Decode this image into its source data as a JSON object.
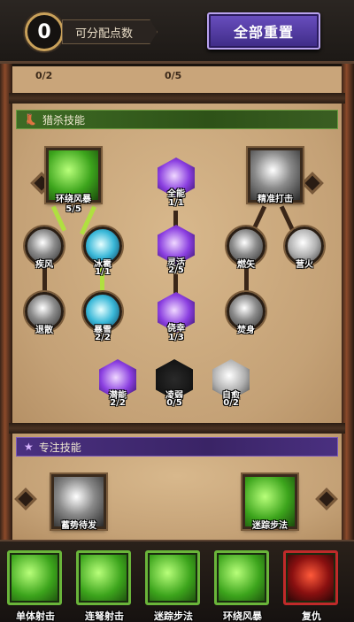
{
  "points": {
    "value": "0",
    "label": "可分配点数"
  },
  "reset_button": {
    "label": "全部重置"
  },
  "top_counters": [
    "0/2",
    "0/5"
  ],
  "hunting_section": {
    "title": "猎杀技能",
    "nodes": [
      {
        "name": "环绕风暴",
        "count": "5/5",
        "icon": "whirlwind-icon",
        "color": "green"
      },
      {
        "name": "全能",
        "count": "1/1",
        "icon": "versatility-icon",
        "color": "purple"
      },
      {
        "name": "精准打击",
        "count": "",
        "icon": "precise-strike-icon",
        "color": "gray"
      },
      {
        "name": "疾风",
        "count": "",
        "icon": "gale-icon",
        "color": "gray"
      },
      {
        "name": "冰雹",
        "count": "1/1",
        "icon": "hail-icon",
        "color": "cyan"
      },
      {
        "name": "灵活",
        "count": "2/5",
        "icon": "agility-icon",
        "color": "purple"
      },
      {
        "name": "燃矢",
        "count": "",
        "icon": "burning-arrow-icon",
        "color": "gray"
      },
      {
        "name": "营火",
        "count": "",
        "icon": "campfire-icon",
        "color": "gray"
      },
      {
        "name": "退散",
        "count": "",
        "icon": "disperse-icon",
        "color": "gray"
      },
      {
        "name": "暴雪",
        "count": "2/2",
        "icon": "blizzard-icon",
        "color": "cyan"
      },
      {
        "name": "侥幸",
        "count": "1/3",
        "icon": "luck-icon",
        "color": "purple"
      },
      {
        "name": "焚身",
        "count": "",
        "icon": "self-immolate-icon",
        "color": "gray"
      },
      {
        "name": "潜能",
        "count": "2/2",
        "icon": "potential-icon",
        "color": "purple"
      },
      {
        "name": "凌弱",
        "count": "0/5",
        "icon": "bully-icon",
        "color": "dark"
      },
      {
        "name": "自愈",
        "count": "0/2",
        "icon": "self-heal-icon",
        "color": "silver"
      }
    ]
  },
  "focus_section": {
    "title": "专注技能",
    "nodes": [
      {
        "name": "蓄势待发",
        "icon": "charge-icon"
      },
      {
        "name": "迷踪步法",
        "icon": "elusive-step-icon"
      }
    ]
  },
  "bottom_bar": [
    {
      "name": "单体射击",
      "icon": "single-shot-icon"
    },
    {
      "name": "连弩射击",
      "icon": "crossbow-volley-icon"
    },
    {
      "name": "迷踪步法",
      "icon": "elusive-step-icon"
    },
    {
      "name": "环绕风暴",
      "icon": "whirlwind-icon"
    },
    {
      "name": "复仇",
      "icon": "revenge-icon"
    }
  ]
}
